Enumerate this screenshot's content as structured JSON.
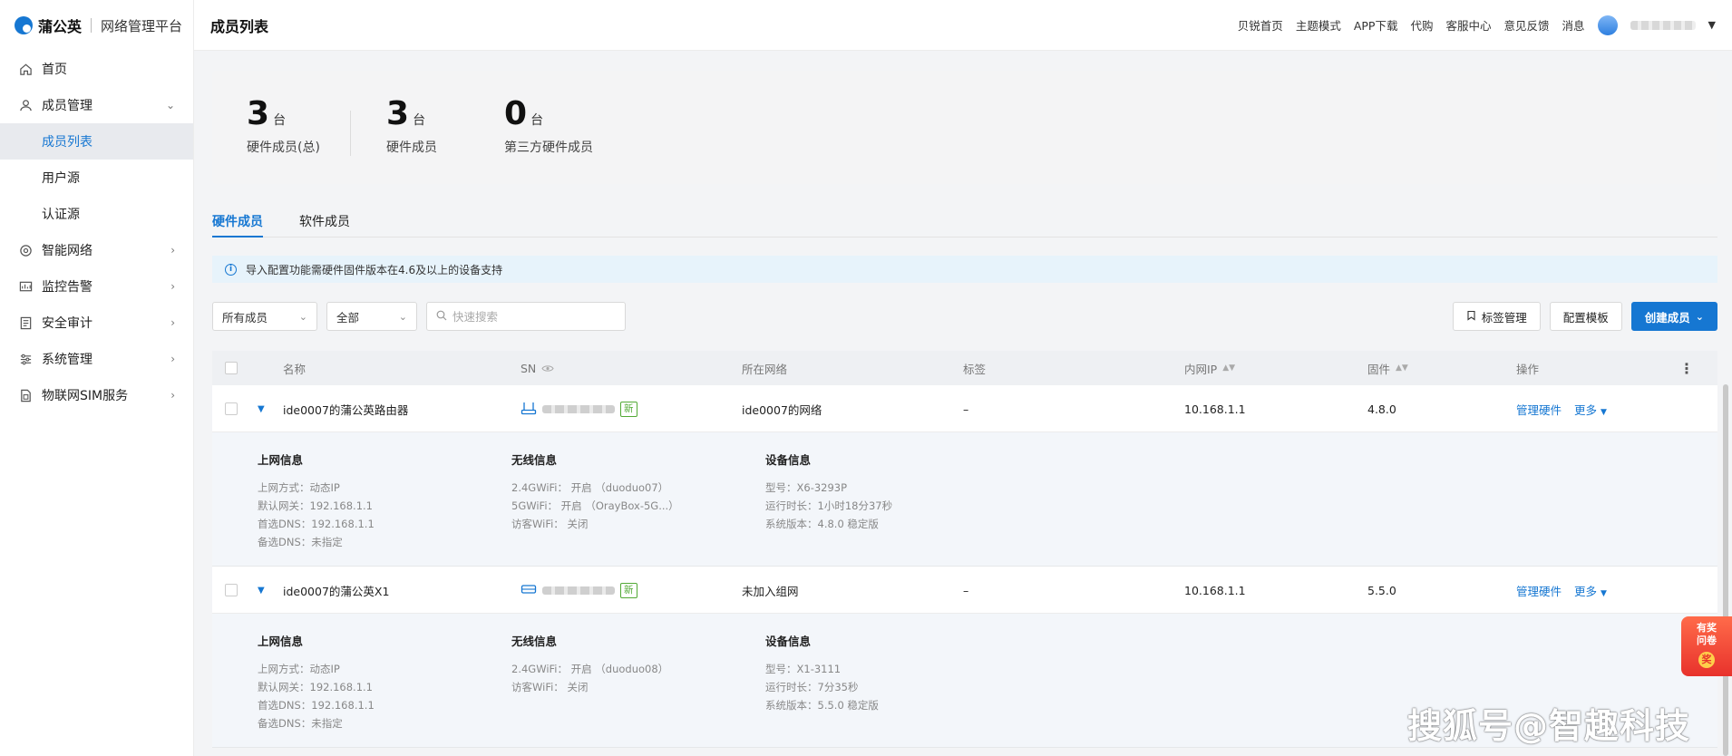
{
  "brand": {
    "name": "蒲公英",
    "subtitle": "网络管理平台"
  },
  "sidebar": {
    "items": [
      {
        "label": "首页",
        "icon": "home-icon"
      },
      {
        "label": "成员管理",
        "icon": "user-icon",
        "expanded": true,
        "children": [
          {
            "label": "成员列表",
            "active": true
          },
          {
            "label": "用户源"
          },
          {
            "label": "认证源"
          }
        ]
      },
      {
        "label": "智能网络",
        "icon": "network-icon"
      },
      {
        "label": "监控告警",
        "icon": "monitor-icon"
      },
      {
        "label": "安全审计",
        "icon": "audit-icon"
      },
      {
        "label": "系统管理",
        "icon": "settings-icon"
      },
      {
        "label": "物联网SIM服务",
        "icon": "sim-icon"
      }
    ]
  },
  "header": {
    "title": "成员列表",
    "links": [
      "贝锐首页",
      "主题模式",
      "APP下载",
      "代购",
      "客服中心",
      "意见反馈",
      "消息"
    ]
  },
  "stats": [
    {
      "value": "3",
      "unit": "台",
      "label": "硬件成员(总)"
    },
    {
      "value": "3",
      "unit": "台",
      "label": "硬件成员"
    },
    {
      "value": "0",
      "unit": "台",
      "label": "第三方硬件成员"
    }
  ],
  "tabs": [
    {
      "label": "硬件成员",
      "active": true
    },
    {
      "label": "软件成员",
      "active": false
    }
  ],
  "notice": "导入配置功能需硬件固件版本在4.6及以上的设备支持",
  "filters": {
    "member_select": "所有成员",
    "status_select": "全部",
    "search_placeholder": "快速搜索"
  },
  "actions": {
    "tag_manage": "标签管理",
    "config_template": "配置模板",
    "create_member": "创建成员"
  },
  "table": {
    "columns": {
      "name": "名称",
      "sn": "SN",
      "network": "所在网络",
      "tag": "标签",
      "ip": "内网IP",
      "firmware": "固件",
      "ops": "操作"
    },
    "rows": [
      {
        "name": "ide0007的蒲公英路由器",
        "badge": "新",
        "network": "ide0007的网络",
        "tag": "–",
        "ip": "10.168.1.1",
        "firmware": "4.8.0",
        "manage": "管理硬件",
        "more": "更多",
        "detail": {
          "internet_title": "上网信息",
          "internet": [
            "上网方式：动态IP",
            "默认网关：192.168.1.1",
            "首选DNS：192.168.1.1",
            "备选DNS：未指定"
          ],
          "wireless_title": "无线信息",
          "wireless": [
            "2.4GWiFi： 开启 （duoduo07）",
            "5GWiFi： 开启 （OrayBox-5G...）",
            "访客WiFi： 关闭"
          ],
          "device_title": "设备信息",
          "device": [
            "型号：X6-3293P",
            "运行时长：1小时18分37秒",
            "系统版本：4.8.0 稳定版"
          ]
        }
      },
      {
        "name": "ide0007的蒲公英X1",
        "badge": "新",
        "network": "未加入组网",
        "tag": "–",
        "ip": "10.168.1.1",
        "firmware": "5.5.0",
        "manage": "管理硬件",
        "more": "更多",
        "detail": {
          "internet_title": "上网信息",
          "internet": [
            "上网方式：动态IP",
            "默认网关：192.168.1.1",
            "首选DNS：192.168.1.1",
            "备选DNS：未指定"
          ],
          "wireless_title": "无线信息",
          "wireless": [
            "2.4GWiFi： 开启 （duoduo08）",
            "访客WiFi： 关闭"
          ],
          "device_title": "设备信息",
          "device": [
            "型号：X1-3111",
            "运行时长：7分35秒",
            "系统版本：5.5.0 稳定版"
          ]
        }
      }
    ]
  },
  "promo": {
    "line1": "有奖",
    "line2": "问卷",
    "coin": "奖"
  },
  "watermark": "搜狐号@智趣科技",
  "colors": {
    "accent": "#1677d2",
    "new_badge": "#52a935",
    "notice_bg": "#e7f3fb"
  }
}
